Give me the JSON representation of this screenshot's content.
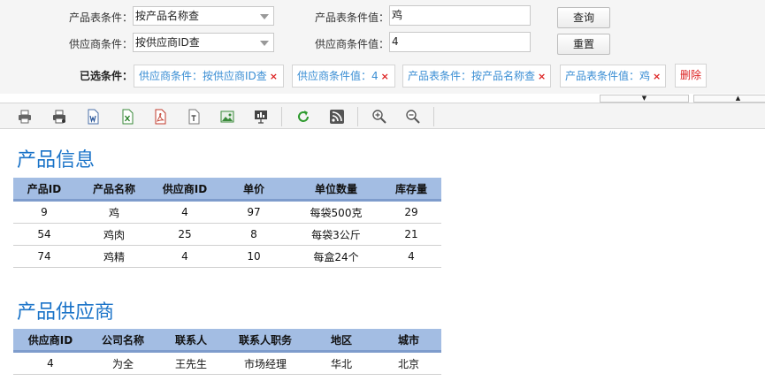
{
  "filters": {
    "product_condition_label": "产品表条件：",
    "product_condition_value": "按产品名称查",
    "product_value_label": "产品表条件值：",
    "product_value": "鸡",
    "supplier_condition_label": "供应商条件：",
    "supplier_condition_value": "按供应商ID查",
    "supplier_value_label": "供应商条件值：",
    "supplier_value": "4",
    "query_button": "查询",
    "reset_button": "重置"
  },
  "selected": {
    "label": "已选条件：",
    "chips": [
      "供应商条件：按供应商ID查",
      "供应商条件值：4",
      "产品表条件：按产品名称查",
      "产品表条件值：鸡"
    ],
    "close_glyph": "×",
    "delete_label": "删除"
  },
  "collapse": {
    "down_glyph": "▼",
    "up_glyph": "▲"
  },
  "toolbar_icons": [
    "print-icon",
    "print-preview-icon",
    "export-word-icon",
    "export-excel-icon",
    "export-pdf-icon",
    "export-text-icon",
    "export-image-icon",
    "present-icon",
    "refresh-icon",
    "rss-icon",
    "zoom-in-icon",
    "zoom-out-icon"
  ],
  "products": {
    "title": "产品信息",
    "columns": [
      "产品ID",
      "产品名称",
      "供应商ID",
      "单价",
      "单位数量",
      "库存量"
    ],
    "rows": [
      [
        "9",
        "鸡",
        "4",
        "97",
        "每袋500克",
        "29"
      ],
      [
        "54",
        "鸡肉",
        "25",
        "8",
        "每袋3公斤",
        "21"
      ],
      [
        "74",
        "鸡精",
        "4",
        "10",
        "每盒24个",
        "4"
      ]
    ]
  },
  "suppliers": {
    "title": "产品供应商",
    "columns": [
      "供应商ID",
      "公司名称",
      "联系人",
      "联系人职务",
      "地区",
      "城市"
    ],
    "rows": [
      [
        "4",
        "为全",
        "王先生",
        "市场经理",
        "华北",
        "北京"
      ]
    ]
  }
}
